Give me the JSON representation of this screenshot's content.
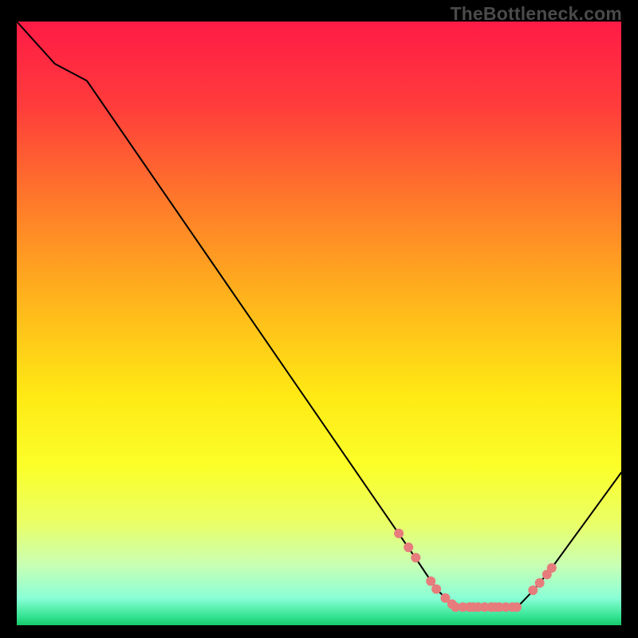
{
  "watermark": "TheBottleneck.com",
  "chart_data": {
    "type": "line",
    "title": "",
    "xlabel": "",
    "ylabel": "",
    "xlim": [
      0,
      100
    ],
    "ylim": [
      0,
      100
    ],
    "grid": false,
    "legend": false,
    "gradient_stops": [
      {
        "offset": 0.0,
        "color": "#ff1b46"
      },
      {
        "offset": 0.14,
        "color": "#ff3c3b"
      },
      {
        "offset": 0.3,
        "color": "#ff7a2a"
      },
      {
        "offset": 0.46,
        "color": "#ffb41c"
      },
      {
        "offset": 0.62,
        "color": "#ffe914"
      },
      {
        "offset": 0.74,
        "color": "#fbff2a"
      },
      {
        "offset": 0.83,
        "color": "#eaff66"
      },
      {
        "offset": 0.9,
        "color": "#c9ffb4"
      },
      {
        "offset": 0.955,
        "color": "#8affd6"
      },
      {
        "offset": 0.985,
        "color": "#35e493"
      },
      {
        "offset": 1.0,
        "color": "#17c96c"
      }
    ],
    "series": [
      {
        "name": "bottleneck-curve",
        "color": "#000000",
        "x": [
          0.0,
          6.3,
          11.6,
          66.4,
          69.4,
          72.5,
          82.8,
          85.2,
          88.0,
          100.0
        ],
        "y": [
          100.0,
          93.0,
          90.2,
          10.5,
          6.0,
          3.0,
          3.0,
          5.5,
          8.8,
          25.3
        ]
      }
    ],
    "markers": {
      "name": "highlight-points",
      "color": "#e77c7c",
      "radius": 6,
      "points": [
        {
          "x": 63.2,
          "y": 15.2
        },
        {
          "x": 64.8,
          "y": 12.9
        },
        {
          "x": 66.0,
          "y": 11.2
        },
        {
          "x": 68.5,
          "y": 7.3
        },
        {
          "x": 69.4,
          "y": 6.0
        },
        {
          "x": 70.9,
          "y": 4.5
        },
        {
          "x": 72.0,
          "y": 3.5
        },
        {
          "x": 72.6,
          "y": 3.0
        },
        {
          "x": 73.8,
          "y": 3.0
        },
        {
          "x": 74.9,
          "y": 3.0
        },
        {
          "x": 75.5,
          "y": 3.0
        },
        {
          "x": 76.3,
          "y": 3.0
        },
        {
          "x": 77.4,
          "y": 3.0
        },
        {
          "x": 78.5,
          "y": 3.0
        },
        {
          "x": 79.1,
          "y": 3.0
        },
        {
          "x": 79.8,
          "y": 3.0
        },
        {
          "x": 80.9,
          "y": 3.0
        },
        {
          "x": 82.0,
          "y": 3.0
        },
        {
          "x": 82.7,
          "y": 3.0
        },
        {
          "x": 85.4,
          "y": 5.8
        },
        {
          "x": 86.5,
          "y": 7.0
        },
        {
          "x": 87.7,
          "y": 8.4
        },
        {
          "x": 88.5,
          "y": 9.5
        }
      ]
    }
  }
}
